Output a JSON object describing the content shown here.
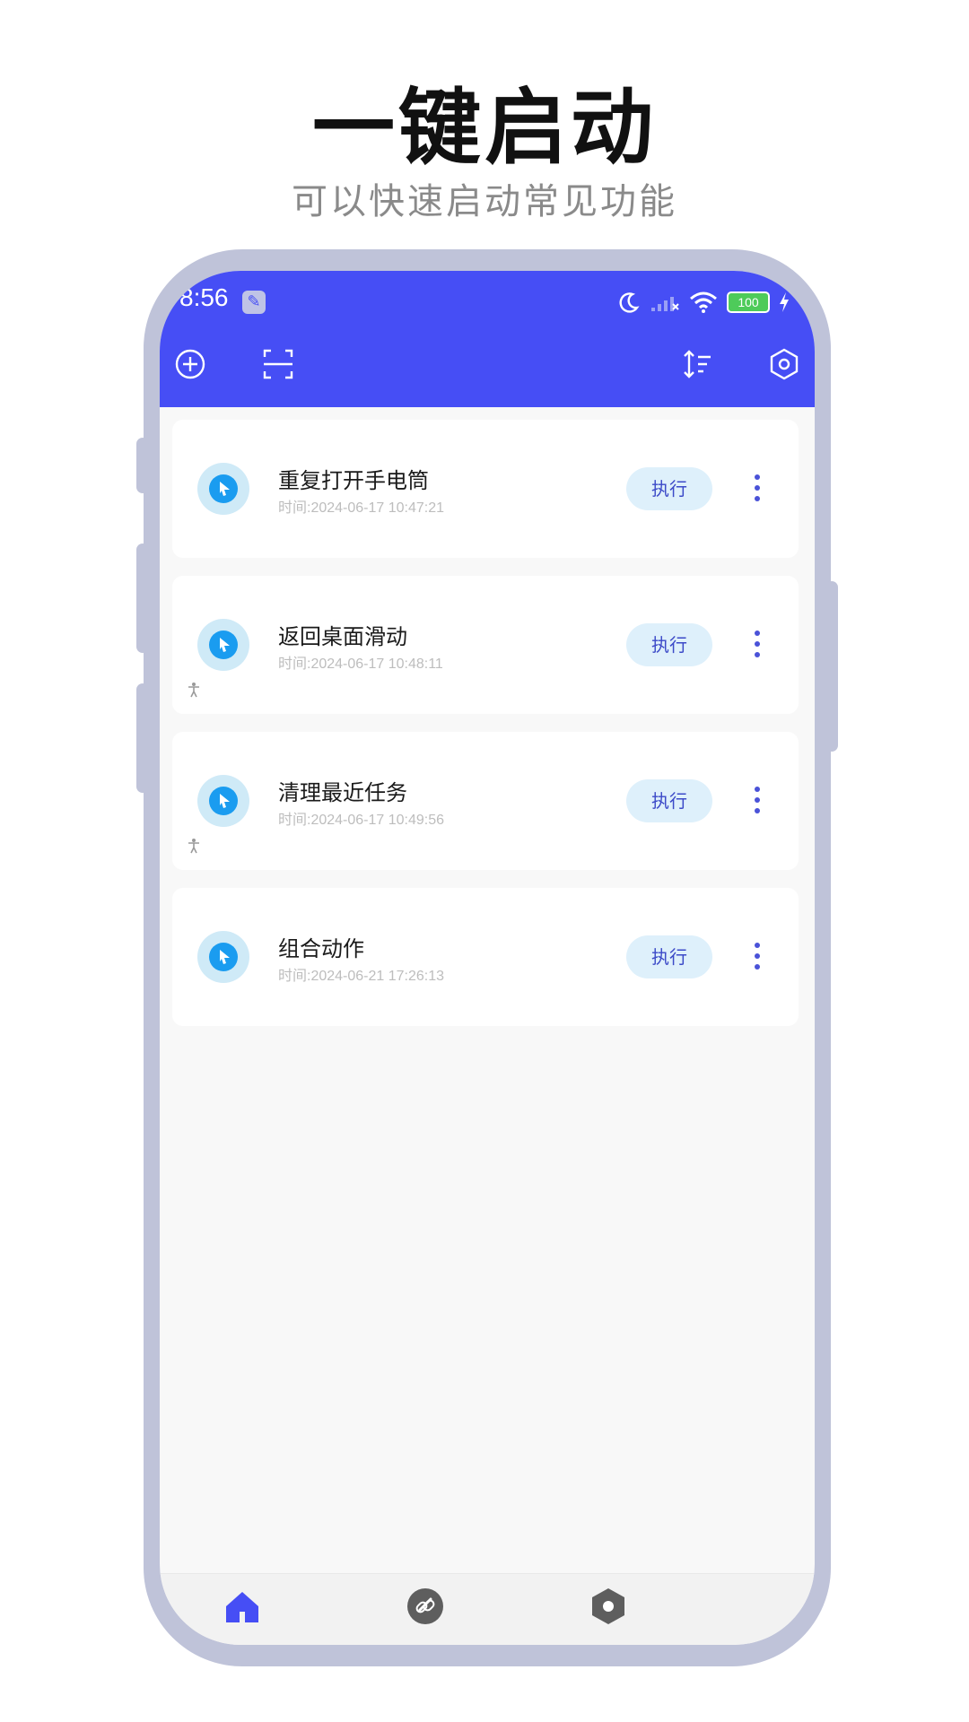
{
  "promo": {
    "title": "一键启动",
    "subtitle": "可以快速启动常见功能"
  },
  "status_bar": {
    "time": "8:56",
    "battery": "100"
  },
  "toolbar": {
    "icons": [
      "add-circle-icon",
      "scan-icon",
      "sort-icon",
      "settings-icon"
    ],
    "color": "#464ef5"
  },
  "tasks": [
    {
      "title": "重复打开手电筒",
      "time": "时间:2024-06-17 10:47:21",
      "action": "执行",
      "has_accessibility": false
    },
    {
      "title": "返回桌面滑动",
      "time": "时间:2024-06-17 10:48:11",
      "action": "执行",
      "has_accessibility": true
    },
    {
      "title": "清理最近任务",
      "time": "时间:2024-06-17 10:49:56",
      "action": "执行",
      "has_accessibility": true
    },
    {
      "title": "组合动作",
      "time": "时间:2024-06-21 17:26:13",
      "action": "执行",
      "has_accessibility": false
    }
  ],
  "bottom_nav": {
    "items": [
      "home-icon",
      "link-icon",
      "settings-icon"
    ],
    "active": "home-icon"
  }
}
